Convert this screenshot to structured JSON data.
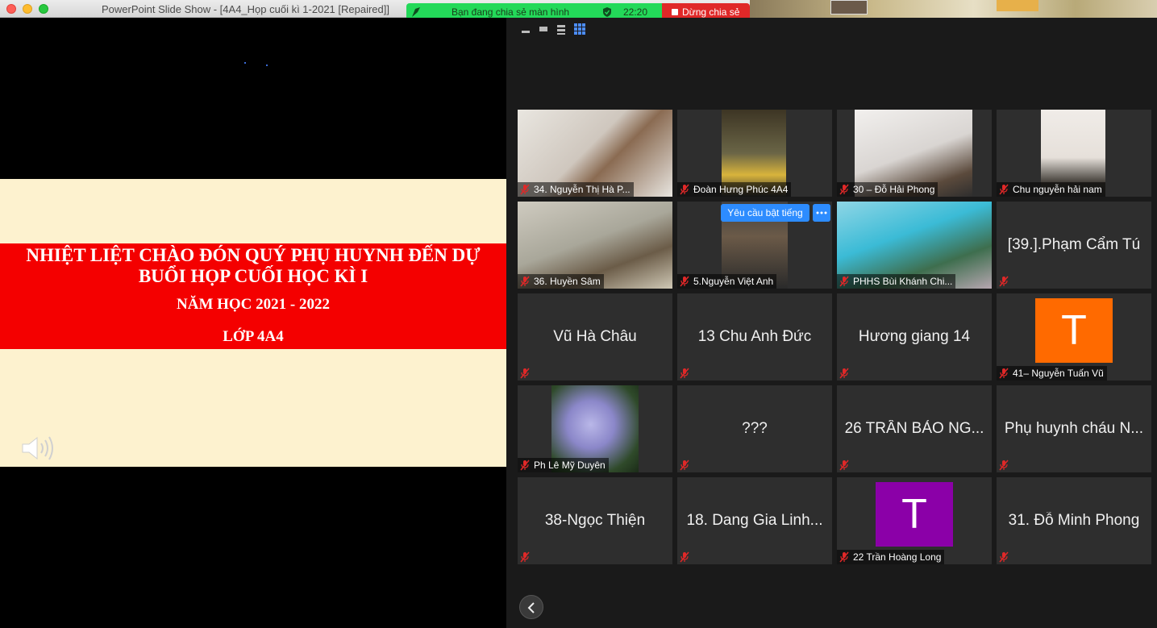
{
  "window": {
    "title": "PowerPoint Slide Show - [4A4_Họp cuối kì 1-2021 [Repaired]]"
  },
  "share_bar": {
    "status": "Bạn đang chia sẻ màn hình",
    "time": "22:20",
    "stop_label": "Dừng chia sẻ"
  },
  "slide": {
    "line1": "NHIỆT LIỆT CHÀO ĐÓN QUÝ PHỤ HUYNH ĐẾN DỰ",
    "line2": "BUỔI HỌP CUỐI HỌC KÌ I",
    "line3": "NĂM HỌC 2021 - 2022",
    "line4": "LỚP 4A4"
  },
  "gallery": {
    "request_unmute": "Yêu cầu bật tiếng",
    "participants": [
      {
        "name": "34. Nguyễn Thị Hà P...",
        "video": true
      },
      {
        "name": "Đoàn Hưng Phúc 4A4",
        "video": true
      },
      {
        "name": "30 – Đỗ Hải Phong",
        "video": true
      },
      {
        "name": "Chu nguyễn hải nam",
        "video": true
      },
      {
        "name": "36. Huyền Sâm",
        "video": true
      },
      {
        "name": "5.Nguyễn Việt Anh",
        "video": true
      },
      {
        "name": "PHHS Bùi Khánh  Chi...",
        "video": true
      },
      {
        "name": "[39.].Phạm Cẩm Tú",
        "video": false
      },
      {
        "name": "Vũ Hà Châu",
        "video": false
      },
      {
        "name": "13 Chu Anh Đức",
        "video": false
      },
      {
        "name": "Hương giang 14",
        "video": false
      },
      {
        "name": "41– Nguyễn Tuấn Vũ",
        "avatar": "T",
        "avatar_color": "#ff6a00"
      },
      {
        "name": "Ph Lê Mỹ Duyên",
        "video": true
      },
      {
        "name": "???",
        "video": false
      },
      {
        "name": "26 TRẦN BẢO NG...",
        "video": false
      },
      {
        "name": "Phụ huynh cháu N...",
        "video": false
      },
      {
        "name": "38-Ngọc Thiện",
        "video": false
      },
      {
        "name": "18. Dang Gia Linh...",
        "video": false
      },
      {
        "name": "22 Trần Hoàng Long",
        "avatar": "T",
        "avatar_color": "#8b00a8"
      },
      {
        "name": "31. Đỗ Minh Phong",
        "video": false
      }
    ]
  }
}
